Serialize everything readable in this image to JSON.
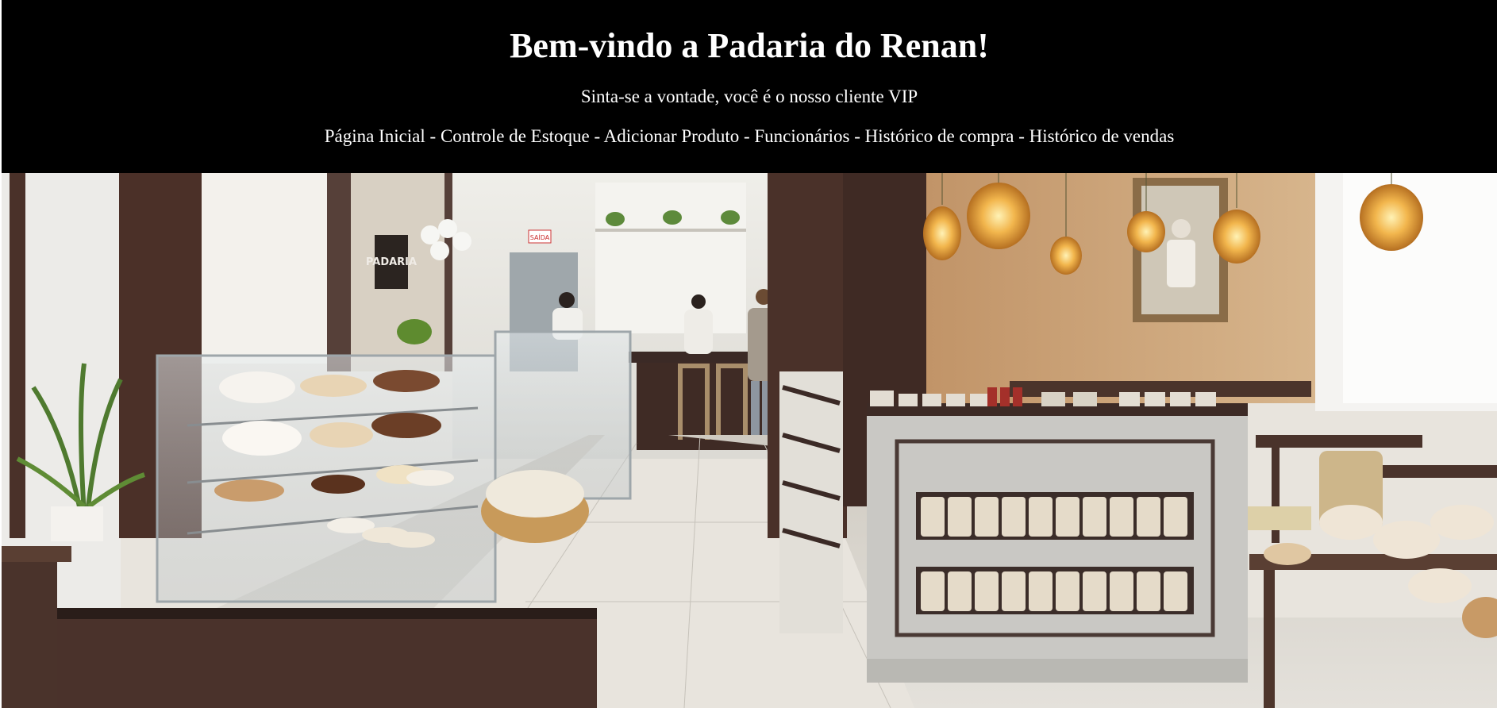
{
  "header": {
    "title": "Bem-vindo a Padaria do Renan!",
    "subtitle": "Sinta-se a vontade, você é o nosso cliente VIP",
    "separator": " - ",
    "nav": [
      {
        "label": "Página Inicial"
      },
      {
        "label": "Controle de Estoque"
      },
      {
        "label": "Adicionar Produto"
      },
      {
        "label": "Funcionários"
      },
      {
        "label": "Histórico de compra"
      },
      {
        "label": "Histórico de vendas"
      }
    ]
  },
  "hero": {
    "sign_text": "PADARIA",
    "exit_sign": "SAÍDA"
  },
  "colors": {
    "header_bg": "#000000",
    "header_text": "#ffffff",
    "wall_warm": "#c9a57a",
    "dark_wood": "#3e2a24",
    "floor": "#d9d6cf"
  }
}
